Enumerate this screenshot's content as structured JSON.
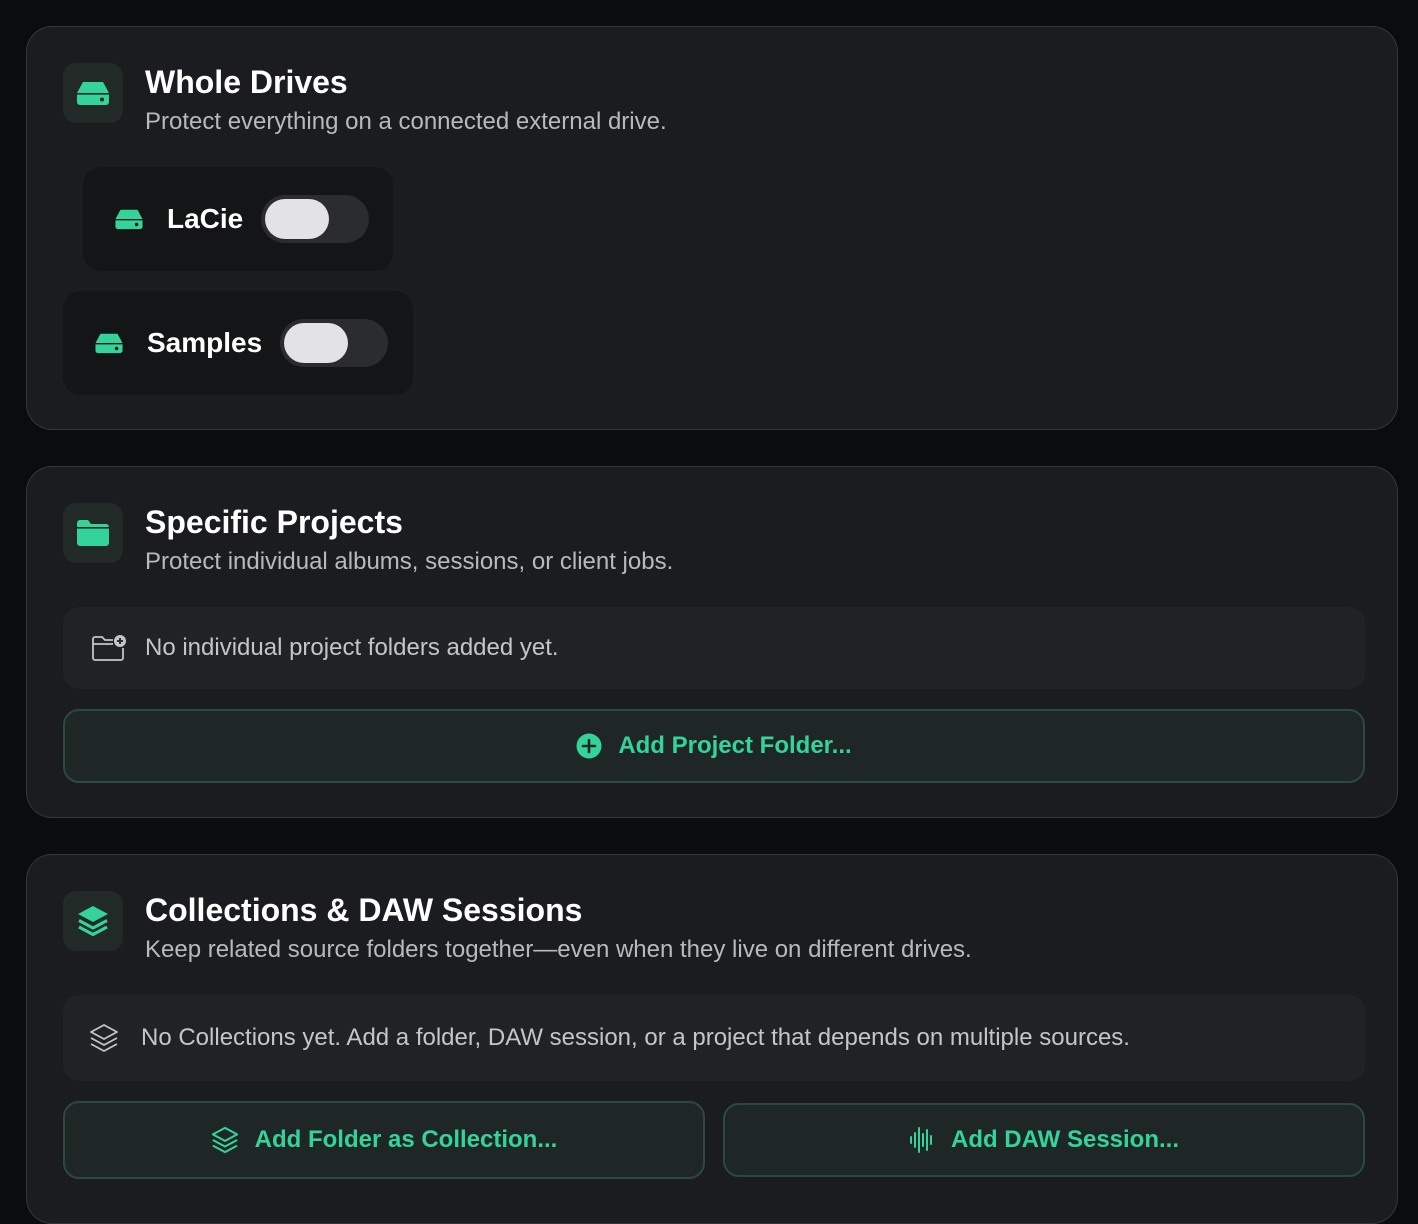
{
  "accent_color": "#34d399",
  "whole_drives": {
    "icon": "drive-icon",
    "title": "Whole Drives",
    "subtitle": "Protect everything on a connected external drive.",
    "drives": [
      {
        "label": "LaCie",
        "icon": "drive-icon",
        "enabled": false
      },
      {
        "label": "Samples",
        "icon": "drive-icon",
        "enabled": false
      }
    ]
  },
  "specific_projects": {
    "icon": "folder-icon",
    "title": "Specific Projects",
    "subtitle": "Protect individual albums, sessions, or client jobs.",
    "empty_icon": "folder-add-icon",
    "empty_text": "No individual project folders added yet.",
    "add_button": {
      "label": "Add Project Folder...",
      "icon": "plus-circle-icon"
    }
  },
  "collections": {
    "icon": "layers-icon",
    "title": "Collections & DAW Sessions",
    "subtitle": "Keep related source folders together—even when they live on different drives.",
    "empty_icon": "layers-icon",
    "empty_text": "No Collections yet. Add a folder, DAW session, or a project that depends on multiple sources.",
    "add_collection_button": {
      "label": "Add Folder as Collection...",
      "icon": "layers-icon"
    },
    "add_daw_button": {
      "label": "Add DAW Session...",
      "icon": "waveform-icon"
    }
  }
}
